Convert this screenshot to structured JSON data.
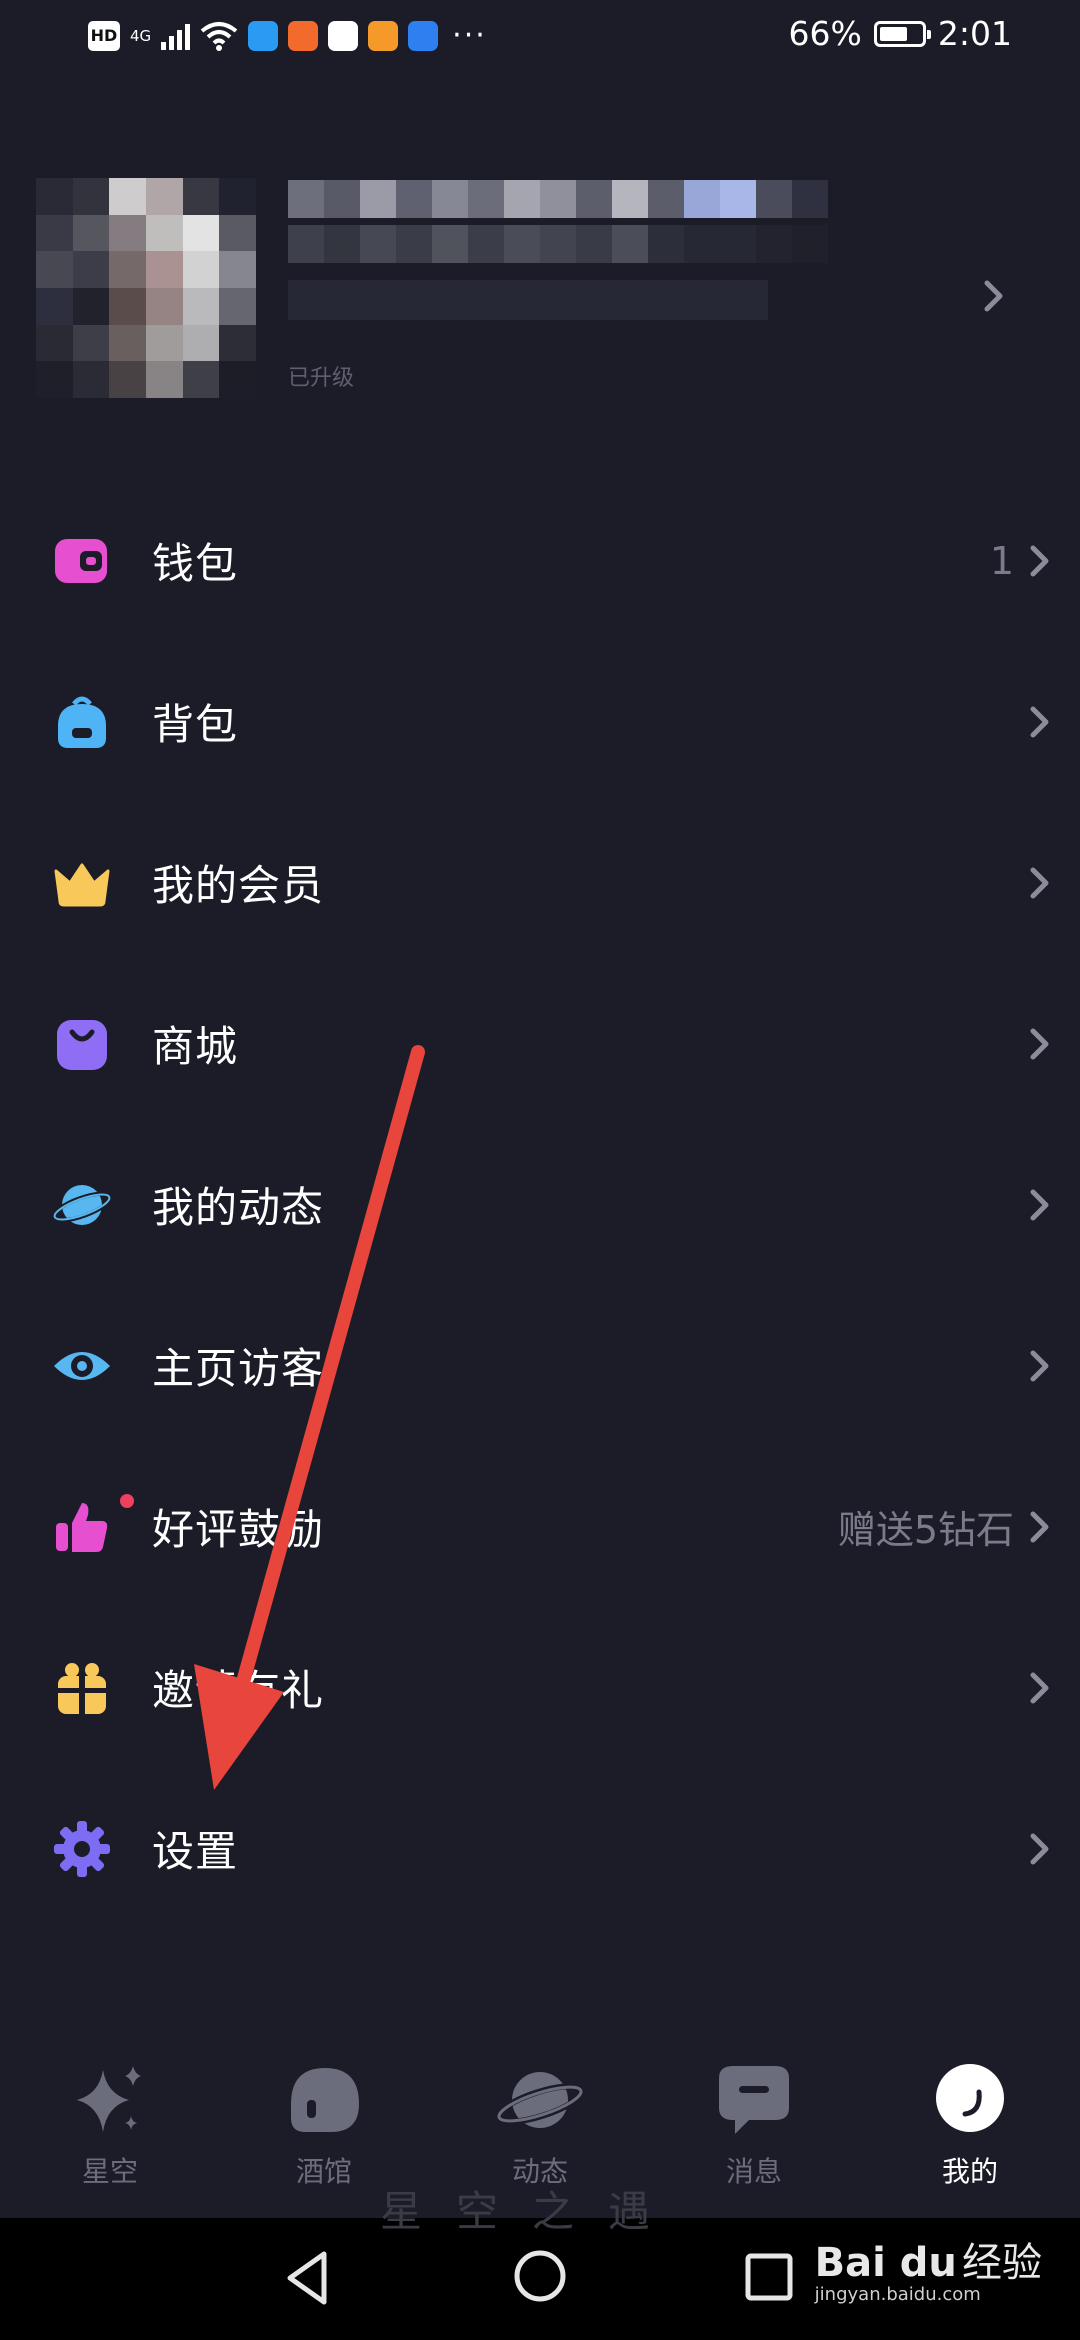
{
  "status_bar": {
    "hd": "HD",
    "network": "4G",
    "battery_percent": "66%",
    "battery_level": 0.66,
    "time": "2:01",
    "more": "···"
  },
  "profile": {
    "level_text": "已升级"
  },
  "menu": {
    "items": [
      {
        "label": "钱包",
        "icon": "wallet-icon",
        "right": "1",
        "color": "#e54fd0"
      },
      {
        "label": "背包",
        "icon": "backpack-icon",
        "right": "",
        "color": "#4fb4f5"
      },
      {
        "label": "我的会员",
        "icon": "crown-icon",
        "right": "",
        "color": "#f8c95a"
      },
      {
        "label": "商城",
        "icon": "shopping-bag-icon",
        "right": "",
        "color": "#8f6df5"
      },
      {
        "label": "我的动态",
        "icon": "planet-icon",
        "right": "",
        "color": "#58b7f0"
      },
      {
        "label": "主页访客",
        "icon": "eye-icon",
        "right": "",
        "color": "#58b7f0"
      },
      {
        "label": "好评鼓励",
        "icon": "thumbs-up-icon",
        "right": "赠送5钻石",
        "color": "#e54fd0"
      },
      {
        "label": "邀请有礼",
        "icon": "gift-icon",
        "right": "",
        "color": "#f8c95a"
      },
      {
        "label": "设置",
        "icon": "gear-icon",
        "right": "",
        "color": "#7d6df5"
      }
    ]
  },
  "tabs": [
    {
      "label": "星空",
      "icon": "sparkle-icon"
    },
    {
      "label": "酒馆",
      "icon": "tavern-icon"
    },
    {
      "label": "动态",
      "icon": "planet-icon"
    },
    {
      "label": "消息",
      "icon": "message-icon"
    },
    {
      "label": "我的",
      "icon": "profile-icon"
    }
  ],
  "system_nav": {
    "watermark": "星空之遇",
    "baidu_logo": "Bai du",
    "baidu_jingyan": "经验",
    "baidu_url": "jingyan.baidu.com"
  }
}
